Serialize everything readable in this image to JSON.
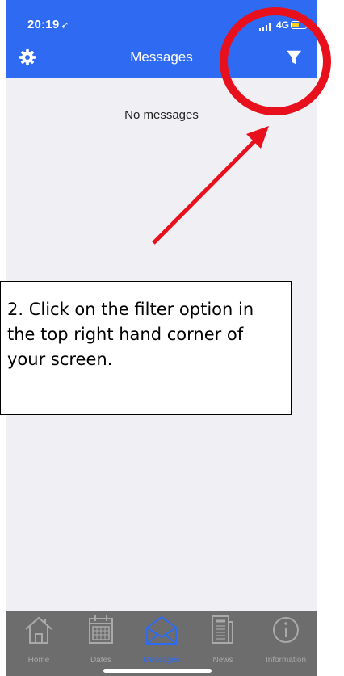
{
  "status_bar": {
    "time": "20:19",
    "location_glyph": "➶",
    "network": "4G",
    "battery_color": "#ffd21f"
  },
  "nav": {
    "title": "Messages",
    "left_icon": "gear-icon",
    "right_icon": "filter-icon",
    "background": "#2f6bf2"
  },
  "main": {
    "empty_text": "No messages"
  },
  "tab_bar": {
    "tabs": [
      {
        "label": "Home",
        "icon": "home-icon"
      },
      {
        "label": "Dates",
        "icon": "calendar-icon"
      },
      {
        "label": "Messages",
        "icon": "envelope-icon",
        "active": true
      },
      {
        "label": "News",
        "icon": "newspaper-icon"
      },
      {
        "label": "Information",
        "icon": "info-icon"
      }
    ]
  },
  "annotation": {
    "callout_text": "2. Click on the filter option in the top right hand corner of your screen.",
    "highlight_color": "#e8101c",
    "arrow_color": "#e8101c"
  }
}
